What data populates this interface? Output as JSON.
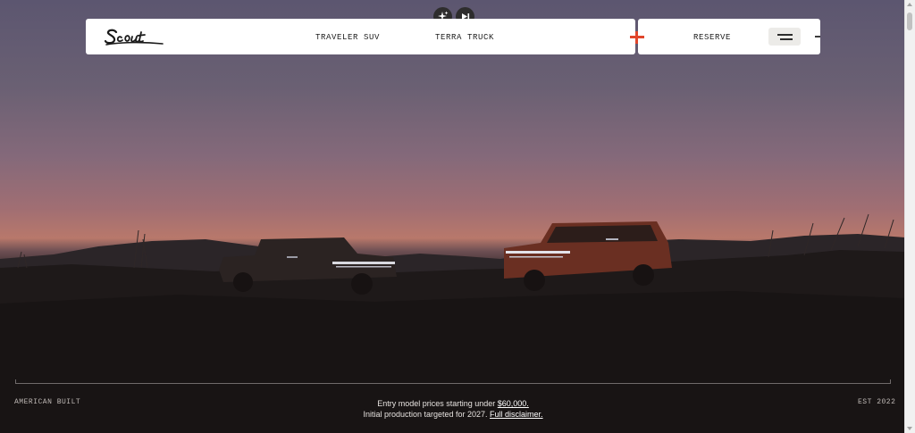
{
  "brand": {
    "logo_text": "Scout"
  },
  "controls": {
    "sparkle_icon": "sparkle-icon",
    "skip_icon": "skip-forward-icon"
  },
  "nav": {
    "links": [
      {
        "label": "TRAVELER SUV"
      },
      {
        "label": "TERRA TRUCK"
      }
    ],
    "reserve_label": "RESERVE",
    "menu_icon": "hamburger-menu-icon"
  },
  "footer": {
    "left_text": "AMERICAN BUILT",
    "right_text": "EST 2022",
    "price_text": "Entry model prices starting under",
    "price_link": "$60,000.",
    "production_text": "Initial production targeted for 2027.",
    "disclaimer_link": "Full disclaimer."
  },
  "colors": {
    "accent": "#e0452b",
    "nav_bg": "#ffffff"
  }
}
